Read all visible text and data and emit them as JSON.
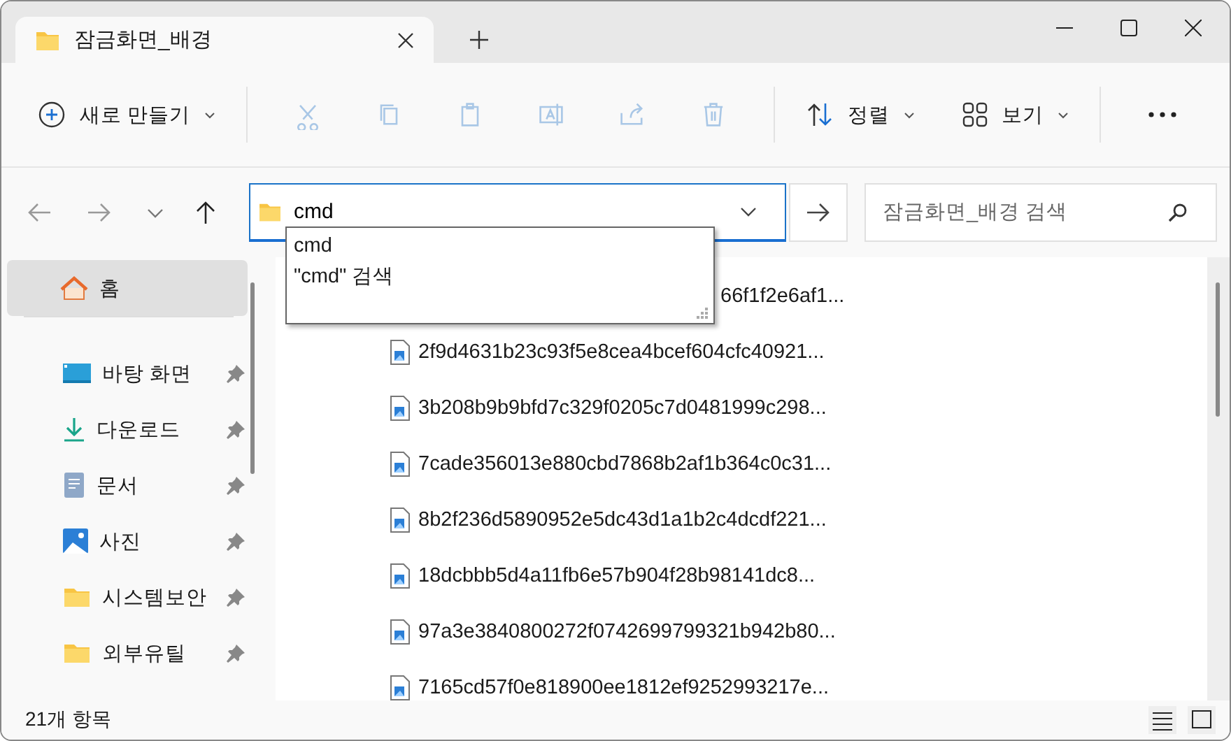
{
  "window": {
    "tabs": [
      {
        "title": "잠금화면_배경",
        "selected": true
      }
    ]
  },
  "toolbar": {
    "new_button": {
      "label": "새로 만들기"
    },
    "actions": [
      {
        "kind": "cut",
        "disabled": true
      },
      {
        "kind": "copy",
        "disabled": true
      },
      {
        "kind": "paste",
        "disabled": true
      },
      {
        "kind": "rename",
        "disabled": true
      },
      {
        "kind": "share",
        "disabled": true
      },
      {
        "kind": "delete",
        "disabled": true
      }
    ],
    "sort_button": {
      "label": "정렬"
    },
    "view_button": {
      "label": "보기"
    }
  },
  "navigation": {
    "back": {
      "disabled": true
    },
    "forward": {
      "disabled": true
    },
    "up": {
      "disabled": false
    }
  },
  "address_bar": {
    "value": "cmd",
    "suggestions": [
      "cmd",
      "\"cmd\" 검색"
    ]
  },
  "search": {
    "placeholder": "잠금화면_배경 검색"
  },
  "sidebar": {
    "items": [
      {
        "label": "홈",
        "kind": "home",
        "selected": true,
        "pinned": false
      },
      {
        "label": "바탕 화면",
        "kind": "desktop",
        "selected": false,
        "pinned": true
      },
      {
        "label": "다운로드",
        "kind": "download",
        "selected": false,
        "pinned": true
      },
      {
        "label": "문서",
        "kind": "document",
        "selected": false,
        "pinned": true
      },
      {
        "label": "사진",
        "kind": "picture",
        "selected": false,
        "pinned": true
      },
      {
        "label": "시스템보안",
        "kind": "folder",
        "selected": false,
        "pinned": true
      },
      {
        "label": "외부유틸",
        "kind": "folder",
        "selected": false,
        "pinned": true
      }
    ]
  },
  "files": [
    {
      "name": "66f1f2e6af1...",
      "kind": "covered"
    },
    {
      "name": "2f9d4631b23c93f5e8cea4bcef604cfc40921...",
      "kind": "image"
    },
    {
      "name": "3b208b9b9bfd7c329f0205c7d0481999c298...",
      "kind": "image"
    },
    {
      "name": "7cade356013e880cbd7868b2af1b364c0c31...",
      "kind": "image"
    },
    {
      "name": "8b2f236d5890952e5dc43d1a1b2c4dcdf221...",
      "kind": "image"
    },
    {
      "name": "18dcbbb5d4a11fb6e57b904f28b98141dc8...",
      "kind": "image"
    },
    {
      "name": "97a3e3840800272f0742699799321b942b80...",
      "kind": "image"
    },
    {
      "name": "7165cd57f0e818900ee1812ef9252993217e...",
      "kind": "image"
    }
  ],
  "status_bar": {
    "count": "21개 항목"
  }
}
